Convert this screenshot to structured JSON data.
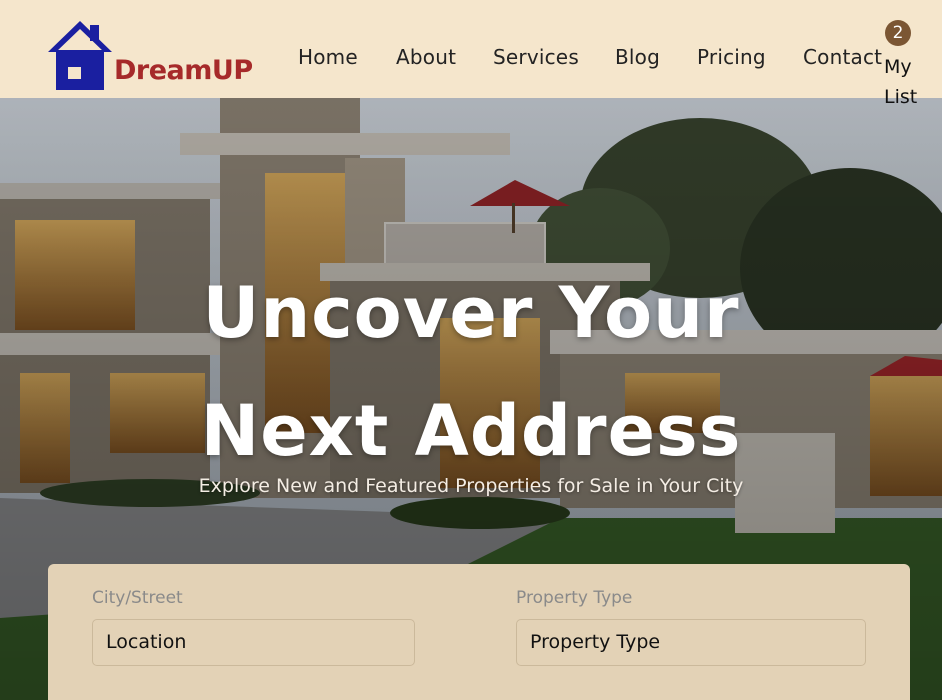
{
  "brand": {
    "name": "DreamUP",
    "logo_icon": "house-icon"
  },
  "nav": {
    "items": [
      {
        "label": "Home"
      },
      {
        "label": "About"
      },
      {
        "label": "Services"
      },
      {
        "label": "Blog"
      },
      {
        "label": "Pricing"
      },
      {
        "label": "Contact"
      }
    ]
  },
  "mylist": {
    "count": "2",
    "label": "My List"
  },
  "hero": {
    "title": "Uncover Your Next Address",
    "subtitle": "Explore New and Featured Properties for Sale in Your City"
  },
  "search": {
    "city": {
      "label": "City/Street",
      "value": "Location"
    },
    "type": {
      "label": "Property Type",
      "value": "Property Type"
    }
  },
  "colors": {
    "header_bg": "#f5e6cc",
    "brand_red": "#a62a2a",
    "logo_blue": "#1a1fa0",
    "badge": "#7b5633",
    "panel_bg": "#e3d2b6"
  }
}
